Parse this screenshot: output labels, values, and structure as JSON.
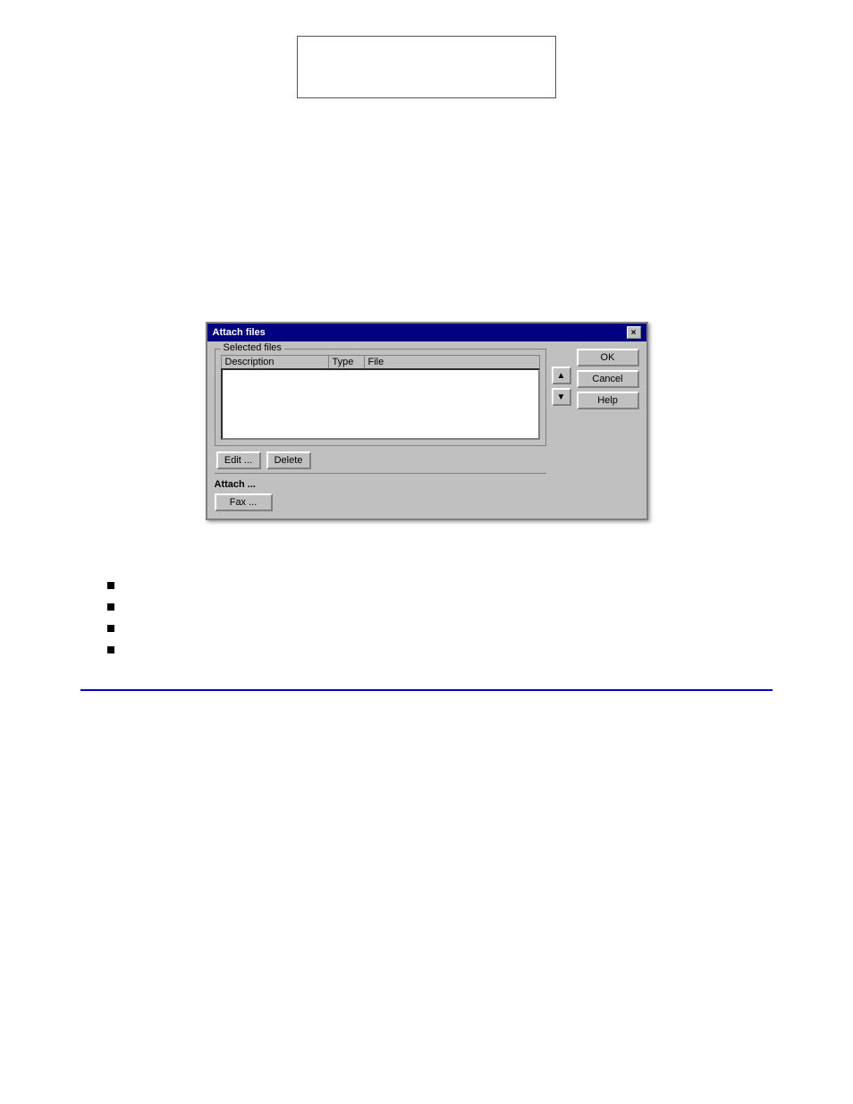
{
  "page": {
    "background_color": "#ffffff"
  },
  "top_figure": {
    "visible": true
  },
  "dialog": {
    "title": "Attach files",
    "close_button": "×",
    "selected_files_group_label": "Selected files",
    "table_headers": {
      "description": "Description",
      "type": "Type",
      "file": "File"
    },
    "buttons": {
      "ok": "OK",
      "cancel": "Cancel",
      "help": "Help",
      "edit": "Edit ...",
      "delete": "Delete",
      "fax": "Fax ..."
    },
    "attach_label": "Attach ..."
  },
  "bullet_items": [
    {
      "id": 1,
      "text": ""
    },
    {
      "id": 2,
      "text": ""
    },
    {
      "id": 3,
      "text": ""
    },
    {
      "id": 4,
      "text": ""
    }
  ]
}
